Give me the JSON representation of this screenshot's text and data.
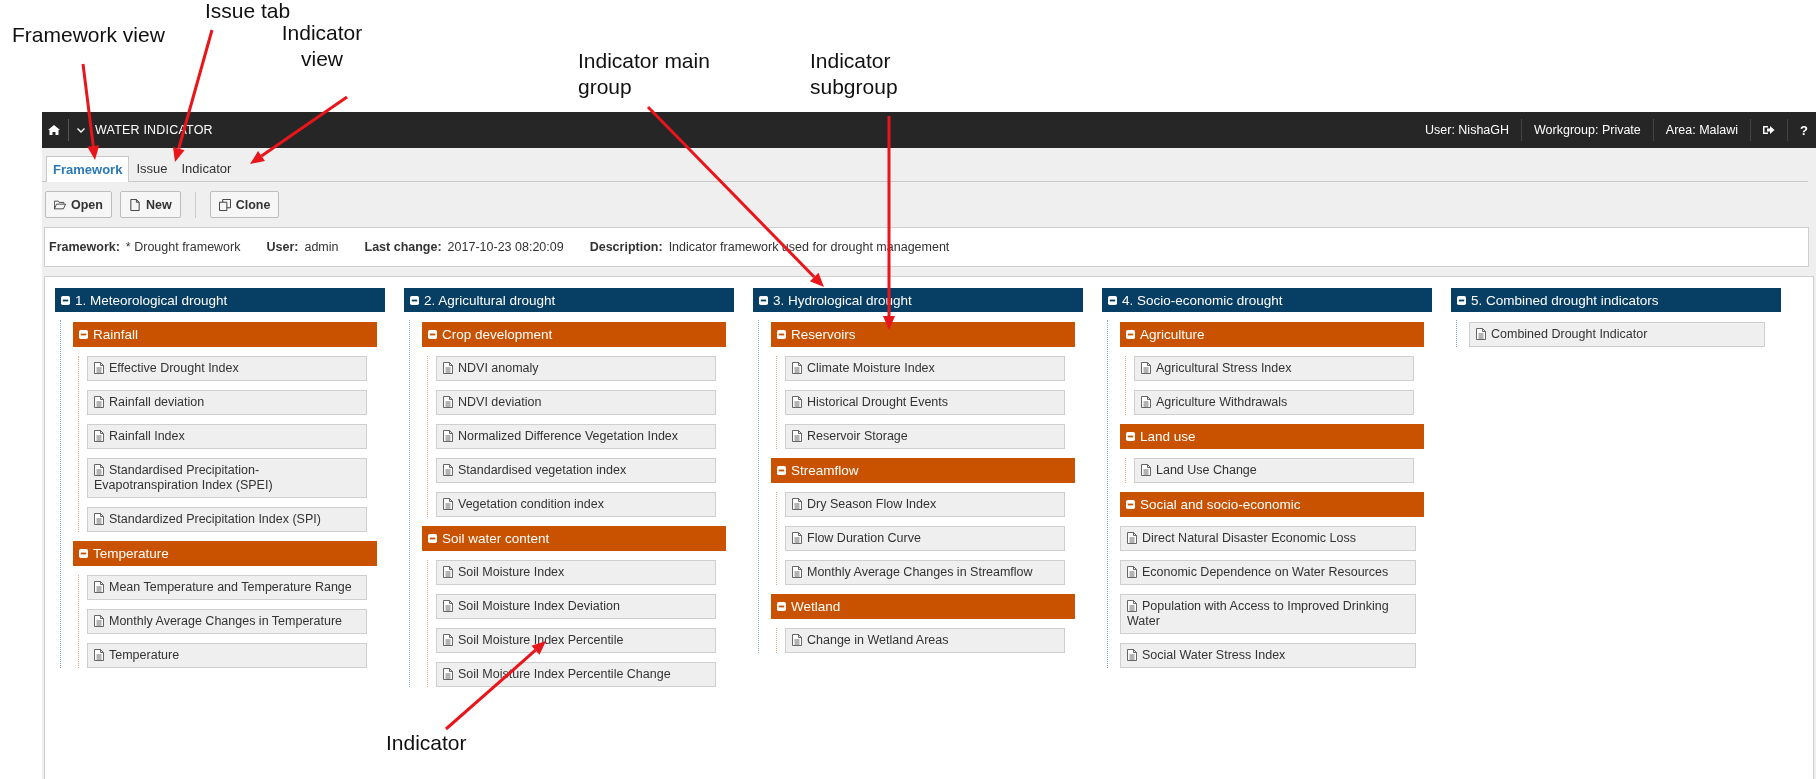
{
  "annotations": [
    {
      "text": "Framework view"
    },
    {
      "text": "Issue tab"
    },
    {
      "text": "Indicator view"
    },
    {
      "text": "Indicator main group"
    },
    {
      "text": "Indicator subgroup"
    },
    {
      "text": "Indicator"
    }
  ],
  "app_bar": {
    "title": "WATER INDICATOR",
    "user": "User: NishaGH",
    "workgroup": "Workgroup: Private",
    "area": "Area: Malawi",
    "help": "?"
  },
  "tabs": [
    {
      "label": "Framework",
      "selected": true
    },
    {
      "label": "Issue",
      "selected": false
    },
    {
      "label": "Indicator",
      "selected": false
    }
  ],
  "toolbar": [
    {
      "label": "Open",
      "kind": "open"
    },
    {
      "label": "New",
      "kind": "new"
    },
    {
      "label": "Clone",
      "kind": "clone"
    }
  ],
  "details": [
    {
      "label": "Framework:",
      "value": "* Drought framework"
    },
    {
      "label": "User:",
      "value": "admin"
    },
    {
      "label": "Last change:",
      "value": "2017-10-23 08:20:09"
    },
    {
      "label": "Description:",
      "value": "Indicator framework used for drought management"
    }
  ],
  "columns": [
    {
      "title": "1. Meteorological drought",
      "expanded": true,
      "children": [
        {
          "kind": "subgroup",
          "title": "Rainfall",
          "expanded": true,
          "children": [
            {
              "label": "Effective Drought Index"
            },
            {
              "label": "Rainfall deviation"
            },
            {
              "label": "Rainfall Index"
            },
            {
              "label": "Standardised Precipitation-Evapotranspiration Index (SPEI)"
            },
            {
              "label": "Standardized Precipitation Index (SPI)"
            }
          ]
        },
        {
          "kind": "subgroup",
          "title": "Temperature",
          "expanded": true,
          "children": [
            {
              "label": "Mean Temperature and Temperature Range"
            },
            {
              "label": "Monthly Average Changes in Temperature"
            },
            {
              "label": "Temperature"
            }
          ]
        }
      ]
    },
    {
      "title": "2. Agricultural drought",
      "expanded": true,
      "children": [
        {
          "kind": "subgroup",
          "title": "Crop development",
          "expanded": true,
          "children": [
            {
              "label": "NDVI anomaly"
            },
            {
              "label": "NDVI deviation"
            },
            {
              "label": "Normalized Difference Vegetation Index"
            },
            {
              "label": "Standardised vegetation index"
            },
            {
              "label": "Vegetation condition index"
            }
          ]
        },
        {
          "kind": "subgroup",
          "title": "Soil water content",
          "expanded": true,
          "children": [
            {
              "label": "Soil Moisture Index"
            },
            {
              "label": "Soil Moisture Index Deviation"
            },
            {
              "label": "Soil Moisture Index Percentile"
            },
            {
              "label": "Soil Moisture Index Percentile Change"
            }
          ]
        }
      ]
    },
    {
      "title": "3. Hydrological drought",
      "expanded": true,
      "children": [
        {
          "kind": "subgroup",
          "title": "Reservoirs",
          "expanded": true,
          "children": [
            {
              "label": "Climate Moisture Index"
            },
            {
              "label": "Historical Drought Events"
            },
            {
              "label": "Reservoir Storage"
            }
          ]
        },
        {
          "kind": "subgroup",
          "title": "Streamflow",
          "expanded": true,
          "children": [
            {
              "label": "Dry Season Flow Index"
            },
            {
              "label": "Flow Duration Curve"
            },
            {
              "label": "Monthly Average Changes in Streamflow"
            }
          ]
        },
        {
          "kind": "subgroup",
          "title": "Wetland",
          "expanded": true,
          "children": [
            {
              "label": "Change in Wetland Areas"
            }
          ]
        }
      ]
    },
    {
      "title": "4. Socio-economic drought",
      "expanded": true,
      "children": [
        {
          "kind": "subgroup",
          "title": "Agriculture",
          "expanded": true,
          "children": [
            {
              "label": "Agricultural Stress Index"
            },
            {
              "label": "Agriculture Withdrawals"
            }
          ]
        },
        {
          "kind": "subgroup",
          "title": "Land use",
          "expanded": true,
          "children": [
            {
              "label": "Land Use Change"
            }
          ]
        },
        {
          "kind": "subgroup",
          "title": "Social and socio-economic",
          "expanded": true
        },
        {
          "kind": "indicator",
          "label": "Direct Natural Disaster Economic Loss"
        },
        {
          "kind": "indicator",
          "label": "Economic Dependence on Water Resources"
        },
        {
          "kind": "indicator",
          "label": "Population with Access to Improved Drinking Water"
        },
        {
          "kind": "indicator",
          "label": "Social Water Stress Index"
        }
      ]
    },
    {
      "title": "5. Combined drought indicators",
      "expanded": true,
      "children": [
        {
          "kind": "indicator",
          "label": "Combined Drought Indicator"
        }
      ]
    }
  ]
}
